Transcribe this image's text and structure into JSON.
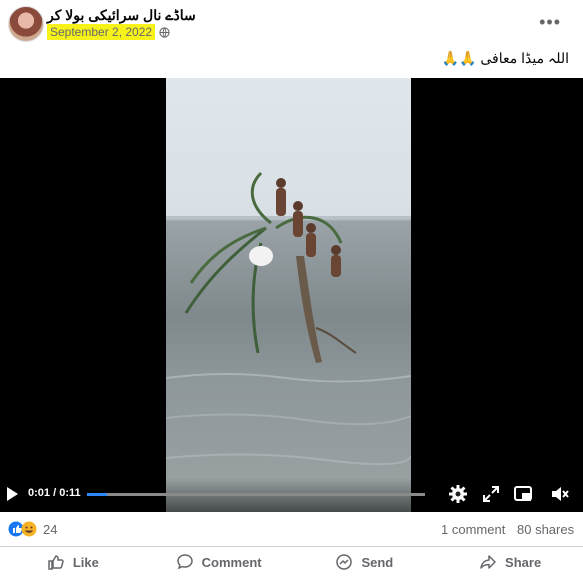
{
  "post": {
    "page_name": "ساڈے نال سرائیکی بولا کر",
    "date": "September 2, 2022",
    "caption": "اللہ میڈا معافی 🙏🙏"
  },
  "video": {
    "current_time": "0:01",
    "duration": "0:11",
    "progress": 0.06
  },
  "stats": {
    "reaction_count": "24",
    "comments": "1 comment",
    "shares": "80 shares"
  },
  "actions": {
    "like": "Like",
    "comment": "Comment",
    "send": "Send",
    "share": "Share"
  },
  "colors": {
    "highlight": "#f7f31a",
    "progress": "#2d88ff",
    "like": "#1877f2",
    "haha": "#f7b125"
  }
}
